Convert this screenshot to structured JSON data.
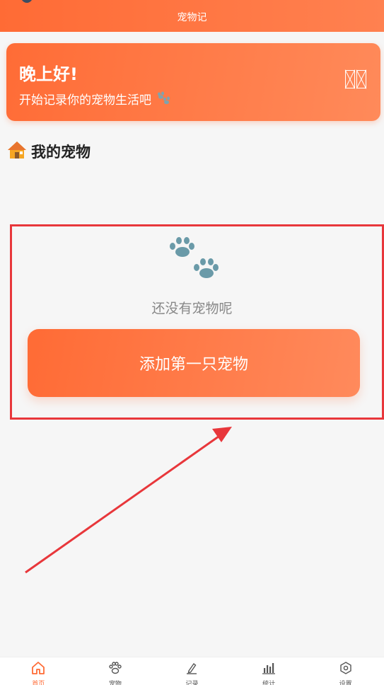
{
  "header": {
    "title": "宠物记"
  },
  "greeting": {
    "title": "晚上好!",
    "subtitle": "开始记录你的宠物生活吧"
  },
  "section": {
    "title": "我的宠物",
    "icon": "house-icon"
  },
  "empty_state": {
    "icon": "paw-prints-icon",
    "text": "还没有宠物呢",
    "button": "添加第一只宠物"
  },
  "nav": {
    "items": [
      {
        "label": "首页",
        "icon": "home-icon",
        "active": true
      },
      {
        "label": "宠物",
        "icon": "paw-icon",
        "active": false
      },
      {
        "label": "记录",
        "icon": "pen-icon",
        "active": false
      },
      {
        "label": "统计",
        "icon": "bar-chart-icon",
        "active": false
      },
      {
        "label": "设置",
        "icon": "settings-icon",
        "active": false
      }
    ]
  },
  "colors": {
    "accent": "#ff6b35",
    "annotation": "#e8373b",
    "paw": "#6a9aa8"
  }
}
